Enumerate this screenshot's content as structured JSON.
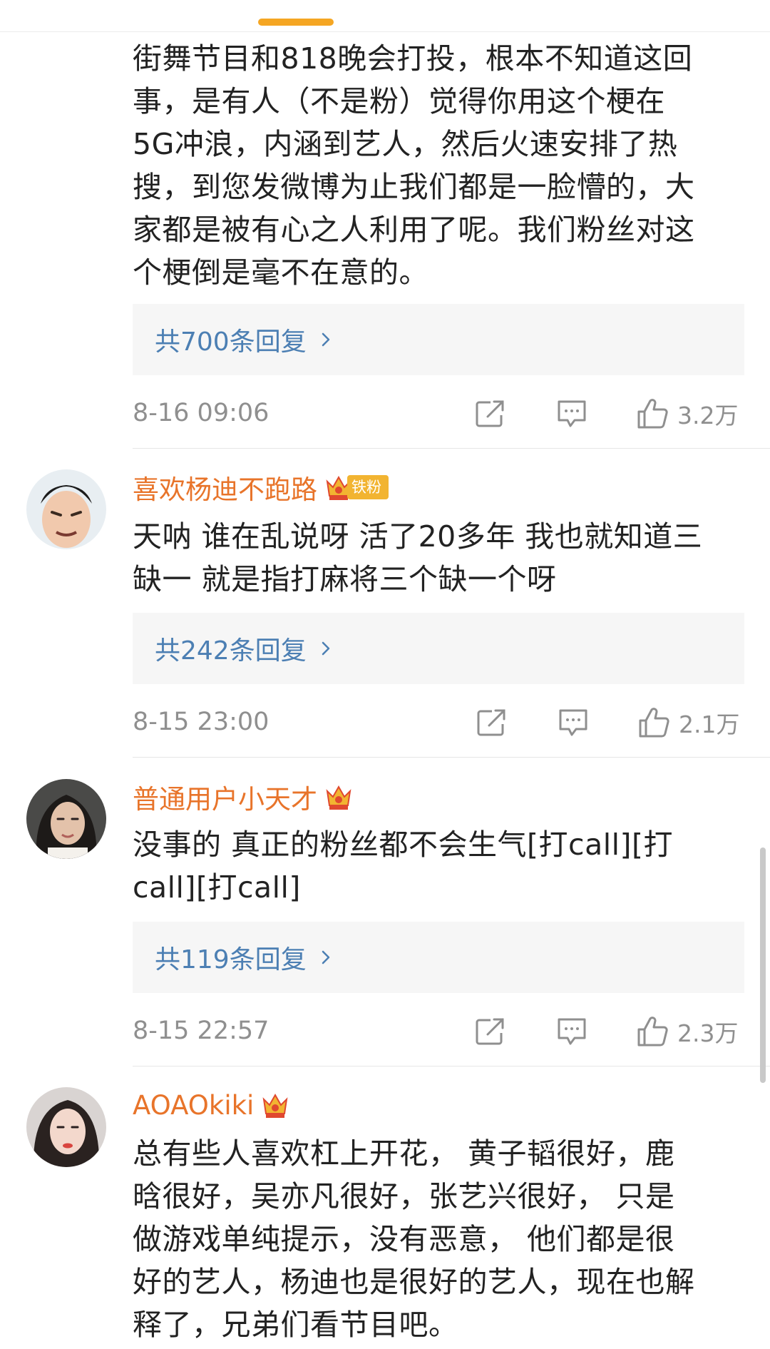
{
  "comments": [
    {
      "username": "",
      "text_lines": [
        "街舞节目和818晚会打投，根本不知道这回",
        "事，是有人（不是粉）觉得你用这个梗在",
        "5G冲浪，内涵到艺人，然后火速安排了热",
        "搜，到您发微博为止我们都是一脸懵的，大",
        "家都是被有心之人利用了呢。我们粉丝对这",
        "个梗倒是毫不在意的。"
      ],
      "replies_label": "共700条回复",
      "time": "8-16 09:06",
      "likes": "3.2万"
    },
    {
      "username": "喜欢杨迪不跑路",
      "fan_badge": "铁粉",
      "text_lines": [
        "天呐 谁在乱说呀 活了20多年 我也就知道三",
        "缺一 就是指打麻将三个缺一个呀"
      ],
      "replies_label": "共242条回复",
      "time": "8-15 23:00",
      "likes": "2.1万"
    },
    {
      "username": "普通用户小天才",
      "text_lines": [
        "没事的 真正的粉丝都不会生气[打call][打",
        "call][打call]"
      ],
      "replies_label": "共119条回复",
      "time": "8-15 22:57",
      "likes": "2.3万"
    },
    {
      "username": "AOAOkiki",
      "text_lines": [
        "总有些人喜欢杠上开花， 黄子韬很好，鹿",
        "晗很好，吴亦凡很好，张艺兴很好， 只是",
        "做游戏单纯提示，没有恶意， 他们都是很",
        "好的艺人，杨迪也是很好的艺人，现在也解",
        "释了，兄弟们看节目吧。"
      ]
    }
  ],
  "icons": {
    "share": "share-icon",
    "comment": "comment-icon",
    "like": "like-icon",
    "chevron": "chevron-right-icon",
    "vip": "vip-crown-icon"
  },
  "colors": {
    "username": "#e8742a",
    "reply_link": "#4c7fb3",
    "meta": "#8f8f8f",
    "reply_bg": "#f6f6f6",
    "tab_indicator": "#f5a623"
  }
}
